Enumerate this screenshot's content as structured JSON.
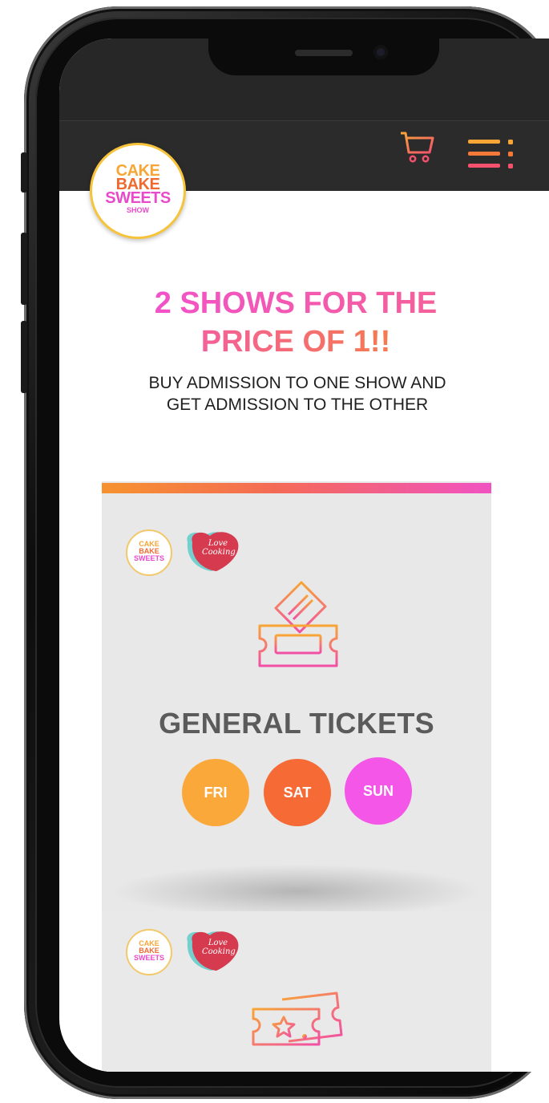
{
  "header": {
    "logo": {
      "line1": "CAKE",
      "line2": "BAKE",
      "line3": "SWEETS",
      "line4": "SHOW"
    },
    "icons": {
      "cart": "cart-icon",
      "menu": "menu-icon"
    }
  },
  "promo": {
    "title": "2 SHOWS FOR THE PRICE OF 1!!",
    "subtitle": "BUY ADMISSION TO ONE SHOW AND GET ADMISSION TO THE OTHER"
  },
  "ticket_card": {
    "mini_logo": {
      "line1": "CAKE",
      "line2": "BAKE",
      "line3": "SWEETS"
    },
    "partner_logo_text": "Love Cooking",
    "heading": "GENERAL TICKETS",
    "days": [
      "FRI",
      "SAT",
      "SUN"
    ],
    "icon": "ticket-icon"
  },
  "second_card": {
    "mini_logo": {
      "line1": "CAKE",
      "line2": "BAKE",
      "line3": "SWEETS"
    },
    "partner_logo_text": "Love Cooking",
    "icon": "vip-ticket-icon"
  },
  "colors": {
    "accent_orange": "#fba83a",
    "accent_red": "#f56a35",
    "accent_pink": "#f457e8",
    "header_bg": "#2b2b2b",
    "card_bg": "#e8e8e8"
  }
}
